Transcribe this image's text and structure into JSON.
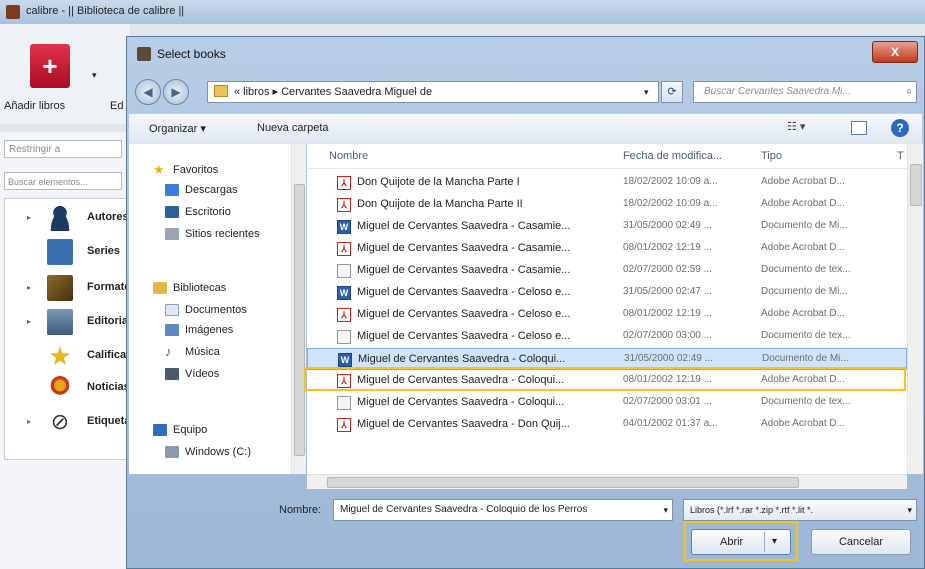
{
  "background": {
    "window_title": "calibre - || Biblioteca de calibre ||",
    "add_books_label": "Añadir libros",
    "e_label": "Ed",
    "restrict_placeholder": "Restringir a",
    "search_placeholder": "Buscar elementos...",
    "tags": [
      {
        "label": "Autores",
        "icon": "person-icon",
        "color": "#1b3b63"
      },
      {
        "label": "Series",
        "icon": "series-icon",
        "color": "#3a6fb0"
      },
      {
        "label": "Formatos",
        "icon": "book-icon",
        "color": "#6b4a1c"
      },
      {
        "label": "Editorial",
        "icon": "publisher-icon",
        "color": "#4a6a88"
      },
      {
        "label": "Calificación",
        "icon": "star-icon",
        "color": "#e8b51a"
      },
      {
        "label": "Noticias",
        "icon": "news-icon",
        "color": "#c83a1e"
      },
      {
        "label": "Etiquetas",
        "icon": "tag-icon",
        "color": "#555555"
      }
    ]
  },
  "dialog": {
    "title": "Select books",
    "close_glyph": "X",
    "breadcrumb": "« libros ▸ Cervantes Saavedra Miguel de",
    "search_placeholder": "Buscar Cervantes Saavedra Mi...",
    "organize": "Organizar ▾",
    "new_folder": "Nueva carpeta",
    "nav": {
      "favorites_label": "Favoritos",
      "favorites": [
        "Descargas",
        "Escritorio",
        "Sitios recientes"
      ],
      "libraries_label": "Bibliotecas",
      "libraries": [
        "Documentos",
        "Imágenes",
        "Música",
        "Vídeos"
      ],
      "computer_label": "Equipo",
      "computer": [
        "Windows (C:)"
      ]
    },
    "columns": {
      "name": "Nombre",
      "date": "Fecha de modifica...",
      "type": "Tipo",
      "extra": "T"
    },
    "files": [
      {
        "name": "Don Quijote de la Mancha Parte I",
        "date": "18/02/2002 10:09 a...",
        "type": "Adobe Acrobat D...",
        "kind": "pdf"
      },
      {
        "name": "Don Quijote de la Mancha Parte II",
        "date": "18/02/2002 10:09 a...",
        "type": "Adobe Acrobat D...",
        "kind": "pdf"
      },
      {
        "name": "Miguel de Cervantes Saavedra - Casamie...",
        "date": "31/05/2000 02:49 ...",
        "type": "Documento de Mi...",
        "kind": "word"
      },
      {
        "name": "Miguel de Cervantes Saavedra - Casamie...",
        "date": "08/01/2002 12:19 ...",
        "type": "Adobe Acrobat D...",
        "kind": "pdf"
      },
      {
        "name": "Miguel de Cervantes Saavedra - Casamie...",
        "date": "02/07/2000 02:59 ...",
        "type": "Documento de tex...",
        "kind": "txt"
      },
      {
        "name": "Miguel de Cervantes Saavedra - Celoso e...",
        "date": "31/05/2000 02:47 ...",
        "type": "Documento de Mi...",
        "kind": "word"
      },
      {
        "name": "Miguel de Cervantes Saavedra - Celoso e...",
        "date": "08/01/2002 12:19 ...",
        "type": "Adobe Acrobat D...",
        "kind": "pdf"
      },
      {
        "name": "Miguel de Cervantes Saavedra - Celoso e...",
        "date": "02/07/2000 03:00 ...",
        "type": "Documento de tex...",
        "kind": "txt"
      },
      {
        "name": "Miguel de Cervantes Saavedra - Coloqui...",
        "date": "31/05/2000 02:49 ...",
        "type": "Documento de Mi...",
        "kind": "word",
        "selected": true
      },
      {
        "name": "Miguel de Cervantes Saavedra - Coloqui...",
        "date": "08/01/2002 12:19 ...",
        "type": "Adobe Acrobat D...",
        "kind": "pdf"
      },
      {
        "name": "Miguel de Cervantes Saavedra - Coloqui...",
        "date": "02/07/2000 03:01 ...",
        "type": "Documento de tex...",
        "kind": "txt"
      },
      {
        "name": "Miguel de Cervantes Saavedra - Don Quij...",
        "date": "04/01/2002 01:37 a...",
        "type": "Adobe Acrobat D...",
        "kind": "pdf"
      }
    ],
    "file_name_label": "Nombre:",
    "file_name_value": "Miguel de Cervantes Saavedra - Coloquio de los Perros",
    "filter_value": "Libros (*.lrf *.rar *.zip *.rtf *.lit *.",
    "open_label": "Abrir",
    "cancel_label": "Cancelar",
    "highlight_color": "#f5c518"
  }
}
